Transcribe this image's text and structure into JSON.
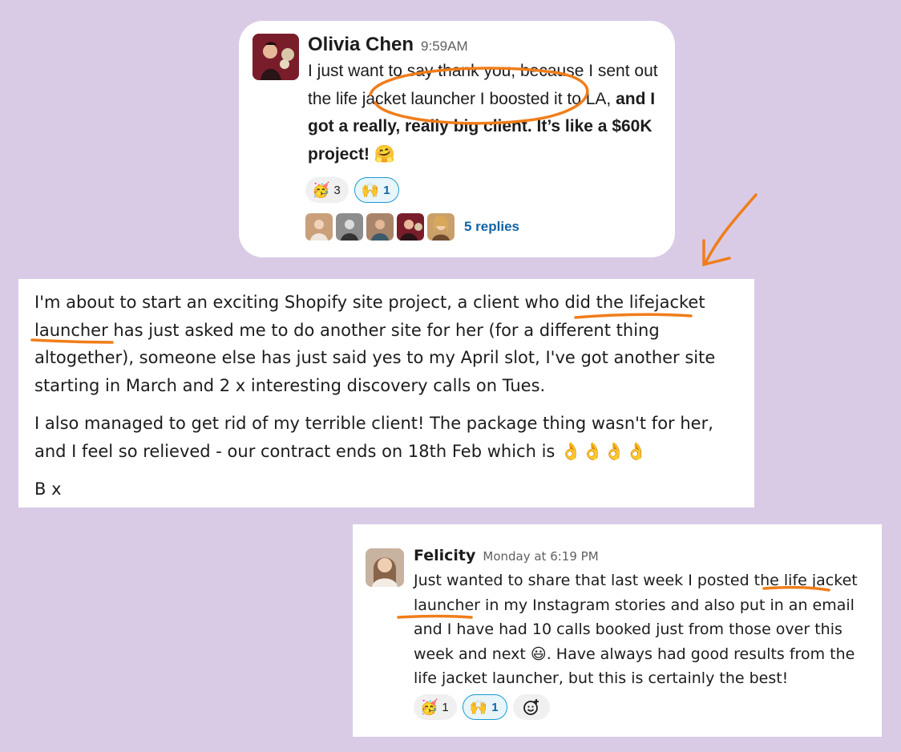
{
  "message1": {
    "author": "Olivia Chen",
    "time": "9:59AM",
    "text_a": "I just want to say thank you, because I sent out the life jacket launcher I boosted it to LA, ",
    "text_b": "and I got a really, really big client. It’s like a $60K project! ",
    "text_emoji": "🤗",
    "reactions": [
      {
        "emoji": "🥳",
        "count": "3"
      },
      {
        "emoji": "🙌",
        "count": "1"
      }
    ],
    "replies_link": "5 replies",
    "reply_avatar_colors": [
      "#c9a07a",
      "#8d8d8d",
      "#a8856a",
      "#7a1d2b",
      "#c9a06a"
    ]
  },
  "message2": {
    "paragraph1": "I'm about to start an exciting Shopify site project, a client who did the lifejacket launcher has just asked me to do another site for her (for a different thing altogether), someone else has just said yes to my April slot, I've got another site starting in March and 2 x interesting discovery calls on Tues.",
    "paragraph2": "I also managed to get rid of my terrible client! The package thing wasn't for her, and I feel so relieved - our contract ends on 18th Feb which is ",
    "paragraph2_emoji": "👌👌👌👌",
    "signoff": "B x"
  },
  "message3": {
    "author": "Felicity",
    "time": "Monday at 6:19 PM",
    "text_a": "Just wanted to share that last week I posted the life jacket launcher in my Instagram stories and also put in an email and I have had 10 calls booked just from those over this week and next ",
    "text_emoji": "😃",
    "text_b": ". Have always had good results from the life jacket launcher, but this is certainly the best!",
    "reactions": [
      {
        "emoji": "🥳",
        "count": "1"
      },
      {
        "emoji": "🙌",
        "count": "1"
      }
    ],
    "add_reaction_icon": "add-emoji-icon"
  },
  "colors": {
    "background": "#d9cbe6",
    "annotation": "#f07d1a",
    "link": "#1264a3"
  }
}
